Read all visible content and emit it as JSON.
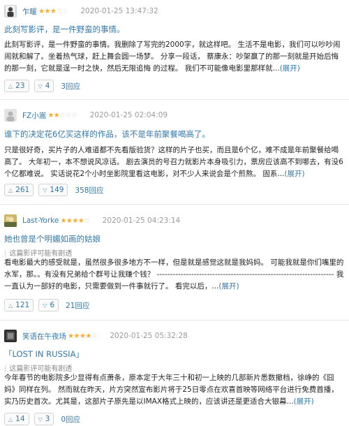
{
  "reviews": [
    {
      "username": "乍暖",
      "stars": "★★★",
      "stars_off": "☆☆",
      "time": "2020-01-25 13:47:32",
      "title": "此刻写影评，是一件野蛮的事情。",
      "notice": "",
      "body": "此刻写影评，是一件野蛮的事情。我删除了写完的2000字，就这样吧。 生活不是电影，我们可以吵吵闹闹就和解了。坐着热气球，赶上舞会圆一场梦。 分享一段话， 蔡康永：吵架赢了的那一刻就是开始后悔的那一刻，它就是逞一时之快，然后无限追悔 的过程。 我们不可能像电影里那样就...",
      "more": "(展开)",
      "up": "23",
      "down": "4",
      "replies": "3回应"
    },
    {
      "username": "FZ小嵩",
      "stars": "★★",
      "stars_off": "☆☆☆",
      "time": "2020-01-25 02:04:09",
      "title": "谁下的决定花6亿买这样的作品，该不是年前聚餐喝高了。",
      "notice": "",
      "body": "只是很好奇，买片子的人难道都不先看版验货？这样的片子也买，而且是6个亿，难不成是年前聚餐给喝高了。 大年初一，本不想说风凉话。 剧去演员的号召力就影片本身吸引力，票房应该高不到哪去，有没6个亿都难说。 实话说花2个小时坐影院里看这电影，对不少人来说会是个煎熬。 固系...",
      "more": "(展开)",
      "up": "261",
      "down": "149",
      "replies": "358回应"
    },
    {
      "username": "Last-Yorke",
      "stars": "★★★★",
      "stars_off": "☆",
      "time": "2020-01-25 04:23:14",
      "title": "她也曾是个明媚如画的姑娘",
      "notice": "这篇影评可能有剧透",
      "body": "看电影最大的感受就是，虽然很多很多地方不一样，但是就是感觉这就是我妈妈。 可能我就是你们嘴里的水军，那。。有没有兄弟给个群号让我赚个钱？ ------------------------------------------------------------------- 我一直认为一部好的电影，只需要做到一件事就行了。 看完以后，...",
      "more": "(展开)",
      "up": "121",
      "down": "6",
      "replies": "21回应"
    },
    {
      "username": "笑语在午夜场",
      "stars": "★★★★",
      "stars_off": "☆",
      "time": "2020-01-25 05:32:28",
      "title": "「LOST IN RUSSIA」",
      "notice": "这篇影评可能有剧透",
      "body": "今年春节的电影院多少显得有点萧条，原本定于大年三十和初一上映的几部新片悉数撤档，徐峥的《囧妈》同样在列。 然而就在昨天，片方突然宣布影片将于25日零点在欢喜首映等网络平台进行免费首播，实乃历史首次。尤其是，这部片子原先是以IMAX格式上映的，应该讲还是更适合大银幕...",
      "more": "(展开)",
      "up": "14",
      "down": "3",
      "replies": "0回应"
    }
  ],
  "icons": {
    "up": "triangle-up-icon",
    "down": "triangle-down-icon"
  },
  "colors": {
    "link": "#3377aa",
    "star": "#ffac2d",
    "muted": "#9b9b9b"
  }
}
